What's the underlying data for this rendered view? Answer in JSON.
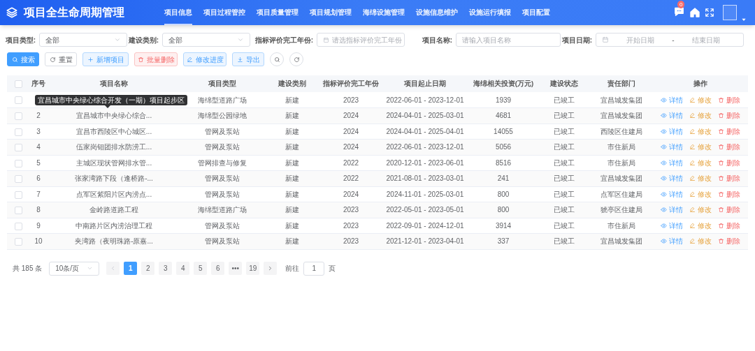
{
  "header": {
    "title": "项目全生命周期管理",
    "message_count": "0",
    "nav": [
      {
        "label": "项目信息",
        "selected": true
      },
      {
        "label": "项目过程管控",
        "selected": false
      },
      {
        "label": "项目质量管理",
        "selected": false
      },
      {
        "label": "项目规划管理",
        "selected": false
      },
      {
        "label": "海绵设施管理",
        "selected": false
      },
      {
        "label": "设施信息维护",
        "selected": false
      },
      {
        "label": "设施运行填报",
        "selected": false
      },
      {
        "label": "项目配置",
        "selected": false
      }
    ]
  },
  "filters": [
    {
      "kind": "select",
      "label": "项目类型:",
      "value": "全部"
    },
    {
      "kind": "select",
      "label": "建设类别:",
      "value": "全部"
    },
    {
      "kind": "date",
      "label": "指标评价完工年份:",
      "placeholder": "请选指标评价完工年份"
    },
    {
      "kind": "input",
      "label": "项目名称:",
      "placeholder": "请输入项目名称"
    },
    {
      "kind": "range",
      "label": "项目日期:",
      "start_placeholder": "开始日期",
      "separator": "-",
      "end_placeholder": "结束日期"
    }
  ],
  "toolbar": [
    {
      "kind": "search",
      "label": "搜索"
    },
    {
      "kind": "reset",
      "label": "重置"
    },
    {
      "kind": "add",
      "label": "新增项目"
    },
    {
      "kind": "delete",
      "label": "批量删除"
    },
    {
      "kind": "edit",
      "label": "修改进度"
    },
    {
      "kind": "export",
      "label": "导出"
    },
    {
      "kind": "search-circle"
    },
    {
      "kind": "refresh-circle"
    }
  ],
  "table": {
    "all_checked": false,
    "columns": [
      "序号",
      "项目名称",
      "项目类型",
      "建设类别",
      "指标评价完工年份",
      "项目起止日期",
      "海绵相关投资(万元)",
      "建设状态",
      "责任部门",
      "操作"
    ],
    "tooltip": "宜昌城市中央绿心综合开发（一期）项目起步区",
    "rows": [
      {
        "checked": false,
        "type": "海绵型道路广场",
        "category": "新建",
        "year": "2023",
        "dates": "2022-06-01 - 2023-12-01",
        "investment": "1939",
        "status": "已竣工",
        "department": "宜昌城发集团",
        "actions": [
          {
            "kind": "view",
            "label": "详情"
          },
          {
            "kind": "edit",
            "label": "修改"
          },
          {
            "kind": "delete",
            "label": "删除"
          }
        ]
      },
      {
        "checked": false,
        "index": "2",
        "name": "宜昌城市中央绿心综合...",
        "type": "海绵型公园绿地",
        "category": "新建",
        "year": "2024",
        "dates": "2024-04-01 - 2025-03-01",
        "investment": "4681",
        "status": "已竣工",
        "department": "宜昌城发集团",
        "actions": [
          {
            "kind": "view",
            "label": "详情"
          },
          {
            "kind": "edit",
            "label": "修改"
          },
          {
            "kind": "delete",
            "label": "删除"
          }
        ]
      },
      {
        "checked": false,
        "index": "3",
        "name": "宜昌市西陵区中心城区...",
        "type": "管网及泵站",
        "category": "新建",
        "year": "2024",
        "dates": "2024-04-01 - 2025-04-01",
        "investment": "14055",
        "status": "已竣工",
        "department": "西陵区住建局",
        "actions": [
          {
            "kind": "view",
            "label": "详情"
          },
          {
            "kind": "edit",
            "label": "修改"
          },
          {
            "kind": "delete",
            "label": "删除"
          }
        ]
      },
      {
        "checked": false,
        "index": "4",
        "name": "伍家岗钼团排水防涝工...",
        "type": "管网及泵站",
        "category": "新建",
        "year": "2024",
        "dates": "2022-06-01 - 2023-12-01",
        "investment": "5056",
        "status": "已竣工",
        "department": "市住新局",
        "actions": [
          {
            "kind": "view",
            "label": "详情"
          },
          {
            "kind": "edit",
            "label": "修改"
          },
          {
            "kind": "delete",
            "label": "删除"
          }
        ]
      },
      {
        "checked": false,
        "index": "5",
        "name": "主城区现状管网排水管...",
        "type": "管网排查与修复",
        "category": "新建",
        "year": "2022",
        "dates": "2020-12-01 - 2023-06-01",
        "investment": "8516",
        "status": "已竣工",
        "department": "市住新局",
        "actions": [
          {
            "kind": "view",
            "label": "详情"
          },
          {
            "kind": "edit",
            "label": "修改"
          },
          {
            "kind": "delete",
            "label": "删除"
          }
        ]
      },
      {
        "checked": false,
        "index": "6",
        "name": "张家湾路下段（逢桥路-...",
        "type": "管网及泵站",
        "category": "新建",
        "year": "2022",
        "dates": "2021-08-01 - 2023-03-01",
        "investment": "241",
        "status": "已竣工",
        "department": "宜昌城发集团",
        "actions": [
          {
            "kind": "view",
            "label": "详情"
          },
          {
            "kind": "edit",
            "label": "修改"
          },
          {
            "kind": "delete",
            "label": "删除"
          }
        ]
      },
      {
        "checked": false,
        "index": "7",
        "name": "点军区紫阳片区内涝点...",
        "type": "管网及泵站",
        "category": "新建",
        "year": "2024",
        "dates": "2024-11-01 - 2025-03-01",
        "investment": "800",
        "status": "已竣工",
        "department": "点军区住建局",
        "actions": [
          {
            "kind": "view",
            "label": "详情"
          },
          {
            "kind": "edit",
            "label": "修改"
          },
          {
            "kind": "delete",
            "label": "删除"
          }
        ]
      },
      {
        "checked": false,
        "index": "8",
        "name": "金岭路道路工程",
        "type": "海绵型道路广场",
        "category": "新建",
        "year": "2023",
        "dates": "2022-05-01 - 2023-05-01",
        "investment": "800",
        "status": "已竣工",
        "department": "猇亭区住建局",
        "actions": [
          {
            "kind": "view",
            "label": "详情"
          },
          {
            "kind": "edit",
            "label": "修改"
          },
          {
            "kind": "delete",
            "label": "删除"
          }
        ]
      },
      {
        "checked": false,
        "index": "9",
        "name": "中南路片区内涝治理工程",
        "type": "管网及泵站",
        "category": "新建",
        "year": "2023",
        "dates": "2022-09-01 - 2024-12-01",
        "investment": "3914",
        "status": "已竣工",
        "department": "市住新局",
        "actions": [
          {
            "kind": "view",
            "label": "详情"
          },
          {
            "kind": "edit",
            "label": "修改"
          },
          {
            "kind": "delete",
            "label": "删除"
          }
        ]
      },
      {
        "checked": false,
        "index": "10",
        "name": "夹湾路（夜明珠路-原嘉...",
        "type": "管网及泵站",
        "category": "新建",
        "year": "2023",
        "dates": "2021-12-01 - 2023-04-01",
        "investment": "337",
        "status": "已竣工",
        "department": "宜昌城发集团",
        "actions": [
          {
            "kind": "view",
            "label": "详情"
          },
          {
            "kind": "edit",
            "label": "修改"
          },
          {
            "kind": "delete",
            "label": "删除"
          }
        ]
      }
    ]
  },
  "pagination": {
    "total": "共 185 条",
    "page_size": "10条/页",
    "pages": [
      {
        "label": "1",
        "selected": true
      },
      {
        "label": "2",
        "selected": false
      },
      {
        "label": "3",
        "selected": false
      },
      {
        "label": "4",
        "selected": false
      },
      {
        "label": "5",
        "selected": false
      },
      {
        "label": "6",
        "selected": false
      },
      {
        "label": "•••",
        "selected": false
      },
      {
        "label": "19",
        "selected": false
      }
    ],
    "goto_label": "前往",
    "goto_value": "1",
    "page_unit": "页"
  }
}
